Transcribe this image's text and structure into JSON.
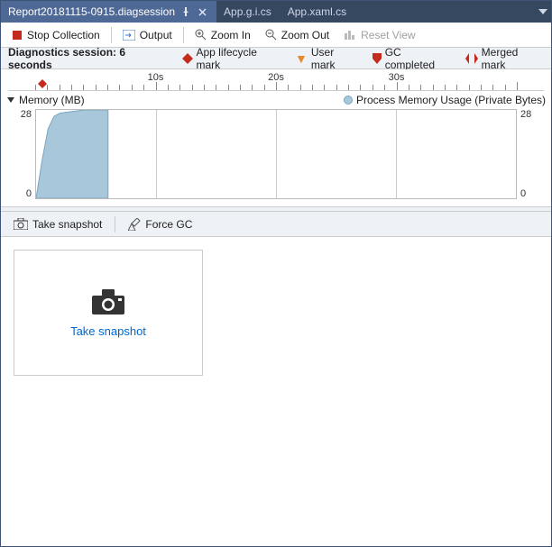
{
  "tabs": [
    {
      "label": "Report20181115-0915.diagsession",
      "active": true
    },
    {
      "label": "App.g.i.cs",
      "active": false
    },
    {
      "label": "App.xaml.cs",
      "active": false
    }
  ],
  "toolbar": {
    "stop_label": "Stop Collection",
    "output_label": "Output",
    "zoom_in_label": "Zoom In",
    "zoom_out_label": "Zoom Out",
    "reset_label": "Reset View"
  },
  "info": {
    "session_prefix": "Diagnostics session: ",
    "session_value": "6 seconds",
    "legend_app": "App lifecycle mark",
    "legend_user": "User mark",
    "legend_gc": "GC completed",
    "legend_merged": "Merged mark"
  },
  "memory": {
    "header_label": "Memory (MB)",
    "series_label": "Process Memory Usage (Private Bytes)"
  },
  "chart_data": {
    "type": "area",
    "title": "Memory (MB)",
    "series_name": "Process Memory Usage (Private Bytes)",
    "xlabel": "seconds",
    "ylabel": "MB",
    "xlim": [
      0,
      40
    ],
    "ylim": [
      0,
      28
    ],
    "x_ticks": [
      10,
      20,
      30
    ],
    "x_tick_labels": [
      "10s",
      "20s",
      "30s"
    ],
    "y_ticks": [
      0,
      28
    ],
    "x": [
      0,
      0.5,
      1,
      1.5,
      2,
      3,
      4,
      5,
      6
    ],
    "y": [
      0,
      12,
      22,
      26,
      27,
      27.5,
      28,
      28,
      28
    ],
    "marks": [
      {
        "type": "app-lifecycle",
        "t": 0.6
      }
    ],
    "colors": {
      "area_fill": "#a8c7da",
      "area_stroke": "#7ba6c2"
    }
  },
  "actions": {
    "take_snapshot": "Take snapshot",
    "force_gc": "Force GC"
  },
  "snapshot_card": {
    "link_label": "Take snapshot"
  }
}
